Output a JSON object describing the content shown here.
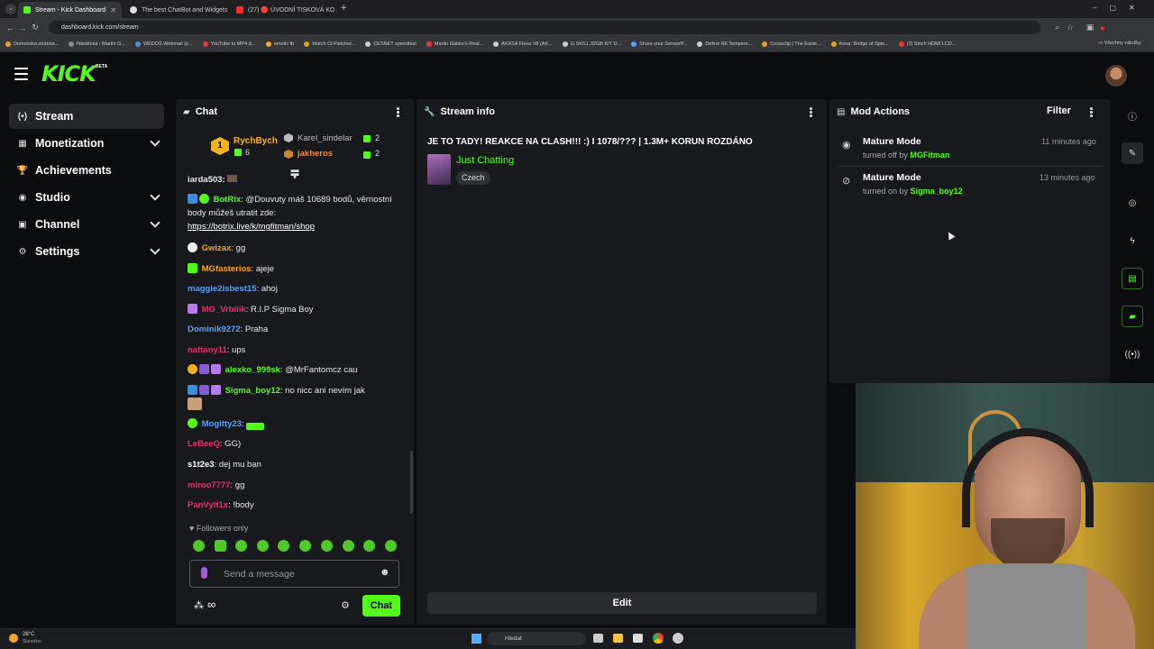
{
  "browser": {
    "tabs": [
      {
        "title": "Stream - Kick Dashboard",
        "color": "#53fc18"
      },
      {
        "title": "The best ChatBot and Widgets",
        "color": "#dddddd"
      },
      {
        "title": "(27) 🔴 ÚVODNÍ TISKOVÁ KONF...",
        "color": "#ff2a2a"
      }
    ],
    "url": "dashboard.kick.com/stream",
    "bookmarks": [
      "Domovská stránka...",
      "Nástěnka ‹ Martin G...",
      "WEDOS Webmail (e...",
      "YouTube to MP4 &...",
      "emotic fb",
      "Watch Ct Fletcher...",
      "CESNET speedtest",
      "Martin Gabko's Real...",
      "AKASA Flexa V8 (AK...",
      "G.SKILL 32GB KIT D...",
      "Share your SensorP...",
      "Define R6 Tempere...",
      "Crossclip | The Easie...",
      "Kena: Bridge of Spiri...",
      "(2) Sinch HDMI LCD..."
    ],
    "all_bookmarks": "Všechny záložky"
  },
  "header": {
    "logo": "KICK",
    "beta": "BETA"
  },
  "nav": [
    {
      "label": "Stream",
      "icon": "(•)",
      "icon_name": "broadcast-icon"
    },
    {
      "label": "Monetization",
      "icon": "▦",
      "icon_name": "monetization-icon"
    },
    {
      "label": "Achievements",
      "icon": "🏆",
      "icon_name": "trophy-icon"
    },
    {
      "label": "Studio",
      "icon": "◉",
      "icon_name": "studio-icon"
    },
    {
      "label": "Channel",
      "icon": "▣",
      "icon_name": "channel-icon"
    },
    {
      "label": "Settings",
      "icon": "⚙",
      "icon_name": "gear-icon"
    }
  ],
  "chat": {
    "title": "Chat",
    "leaders": {
      "rank1": {
        "rank": "1",
        "name": "RychBych",
        "count": "6"
      },
      "rank2": {
        "name": "Karel_sindelar",
        "count": "2"
      },
      "rank3": {
        "name": "jakheros",
        "count": "2"
      }
    },
    "partial_user": "jarda503:",
    "messages": [
      {
        "user": "BotRix",
        "color": "#53fc18",
        "text": ": @Douvuty máš 10689 bodů, věrnostní body můžeš utratit zde:",
        "link": "https://botrix.live/k/mgfitman/shop"
      },
      {
        "user": "Gwizax",
        "color": "#f5a623",
        "text": ": gg"
      },
      {
        "user": "MGfasterios",
        "color": "#f5a623",
        "text": ": ajeje"
      },
      {
        "user": "maggie2isbest15",
        "color": "#5ba0f2",
        "text": ": ahoj"
      },
      {
        "user": "MG_Vrbiiik",
        "color": "#e2336b",
        "text": ": R.I.P Sigma Boy"
      },
      {
        "user": "Dominik9272",
        "color": "#5ba0f2",
        "text": ": Praha"
      },
      {
        "user": "nattany11",
        "color": "#e2336b",
        "text": ": ups"
      },
      {
        "user": "alexko_999sk",
        "color": "#53fc18",
        "text": ": @MrFantomcz cau"
      },
      {
        "user": "Sigma_boy12",
        "color": "#53fc18",
        "text": ": no nicc ani nevím jak"
      },
      {
        "user": "Mogitty23",
        "color": "#5ba0f2",
        "text": ":"
      },
      {
        "user": "LeBeeQ",
        "color": "#e2336b",
        "text": ": GG)"
      },
      {
        "user": "s1t2e3",
        "color": "#ffffff",
        "text": ": dej mu ban"
      },
      {
        "user": "miroo7777",
        "color": "#e2336b",
        "text": ": gg"
      },
      {
        "user": "PanVylt1x",
        "color": "#e2336b",
        "text": ": !body"
      }
    ],
    "followers_only": "Followers only",
    "input_placeholder": "Send a message",
    "send_label": "Chat",
    "infinity": "∞"
  },
  "stream_info": {
    "title": "Stream info",
    "stream_title": "JE TO TADY! REAKCE NA CLASH!!! :) I 1078/??? | 1.3M+ KORUN ROZDÁNO",
    "category": "Just Chatting",
    "language": "Czech",
    "edit_label": "Edit"
  },
  "mod_actions": {
    "title": "Mod Actions",
    "filter_label": "Filter",
    "items": [
      {
        "action": "Mature Mode",
        "detail": "turned off by",
        "user": "MGFitman",
        "time": "11 minutes ago",
        "icon_name": "eye-icon"
      },
      {
        "action": "Mature Mode",
        "detail": "turned on by",
        "user": "Sigma_boy12",
        "time": "13 minutes ago",
        "icon_name": "eye-off-icon"
      }
    ]
  },
  "taskbar": {
    "temp": "28°C",
    "weather": "Slunečno",
    "search": "Hledat"
  },
  "colors": {
    "accent": "#53fc18",
    "panel": "#18191c",
    "bg": "#0b0c0e"
  }
}
